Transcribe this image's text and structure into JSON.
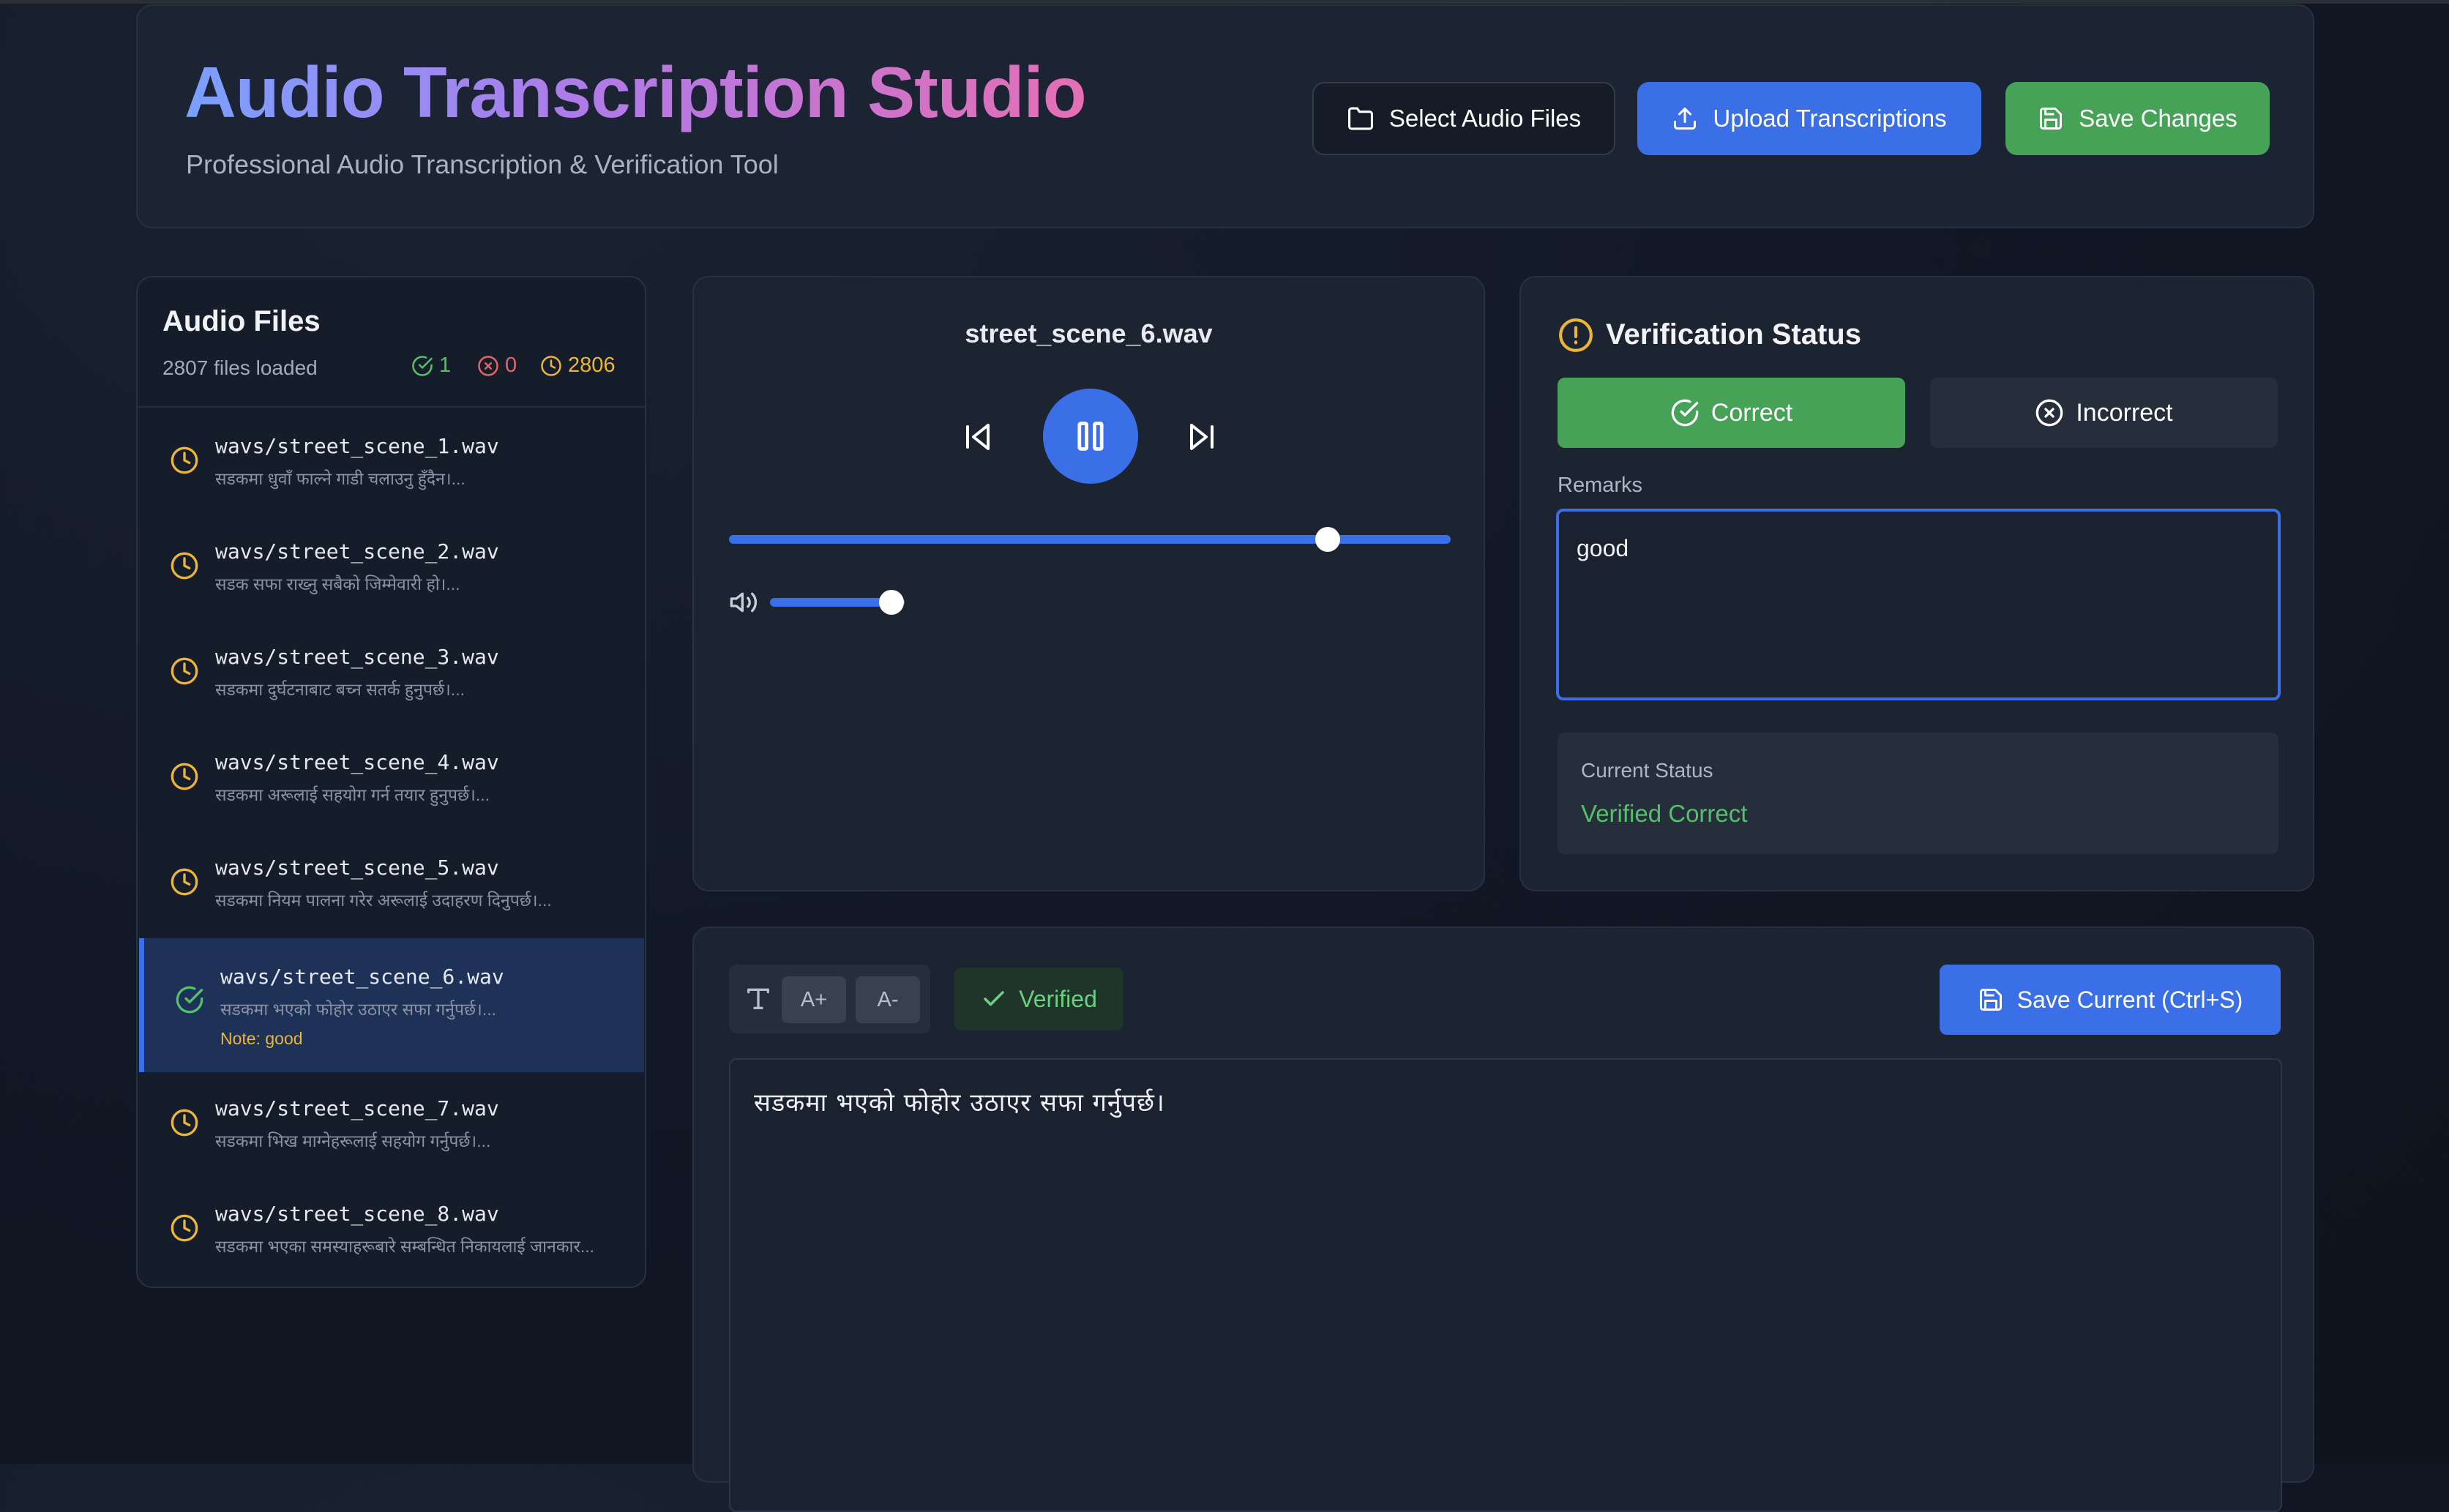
{
  "app": {
    "title": "Audio Transcription Studio",
    "subtitle": "Professional Audio Transcription & Verification Tool"
  },
  "toolbar": {
    "select_label": "Select Audio Files",
    "upload_label": "Upload Transcriptions",
    "save_label": "Save Changes"
  },
  "files_panel": {
    "title": "Audio Files",
    "count_text": "2807 files loaded",
    "stats": {
      "correct": "1",
      "incorrect": "0",
      "pending": "2806"
    },
    "items": [
      {
        "name": "wavs/street_scene_1.wav",
        "preview": "सडकमा धुवाँ फाल्ने गाडी चलाउनु हुँदैन।...",
        "status": "pending",
        "note": ""
      },
      {
        "name": "wavs/street_scene_2.wav",
        "preview": "सडक सफा राख्नु सबैको जिम्मेवारी हो।...",
        "status": "pending",
        "note": ""
      },
      {
        "name": "wavs/street_scene_3.wav",
        "preview": "सडकमा दुर्घटनाबाट बच्न सतर्क हुनुपर्छ।...",
        "status": "pending",
        "note": ""
      },
      {
        "name": "wavs/street_scene_4.wav",
        "preview": "सडकमा अरूलाई सहयोग गर्न तयार हुनुपर्छ।...",
        "status": "pending",
        "note": ""
      },
      {
        "name": "wavs/street_scene_5.wav",
        "preview": "सडकमा नियम पालना गरेर अरूलाई उदाहरण दिनुपर्छ।...",
        "status": "pending",
        "note": ""
      },
      {
        "name": "wavs/street_scene_6.wav",
        "preview": "सडकमा भएको फोहोर उठाएर सफा गर्नुपर्छ।...",
        "status": "correct",
        "note": "Note: good"
      },
      {
        "name": "wavs/street_scene_7.wav",
        "preview": "सडकमा भिख माग्नेहरूलाई सहयोग गर्नुपर्छ।...",
        "status": "pending",
        "note": ""
      },
      {
        "name": "wavs/street_scene_8.wav",
        "preview": "सडकमा भएका समस्याहरूबारे सम्बन्धित निकायलाई जानकार...",
        "status": "pending",
        "note": ""
      }
    ]
  },
  "player": {
    "track_name": "street_scene_6.wav",
    "progress": 0.83,
    "volume": 0.9
  },
  "verification": {
    "title": "Verification Status",
    "correct_label": "Correct",
    "incorrect_label": "Incorrect",
    "remarks_label": "Remarks",
    "remarks_value": "good",
    "current_status_label": "Current Status",
    "current_status_value": "Verified Correct"
  },
  "editor": {
    "font_increase": "A+",
    "font_decrease": "A-",
    "verified_label": "Verified",
    "save_current_label": "Save Current (Ctrl+S)",
    "text": "सडकमा भएको फोहोर उठाएर सफा गर्नुपर्छ।"
  },
  "colors": {
    "accent_blue": "#3b6fe8",
    "success_green": "#45a256",
    "pending_amber": "#eab53a",
    "error_red": "#e26666"
  }
}
